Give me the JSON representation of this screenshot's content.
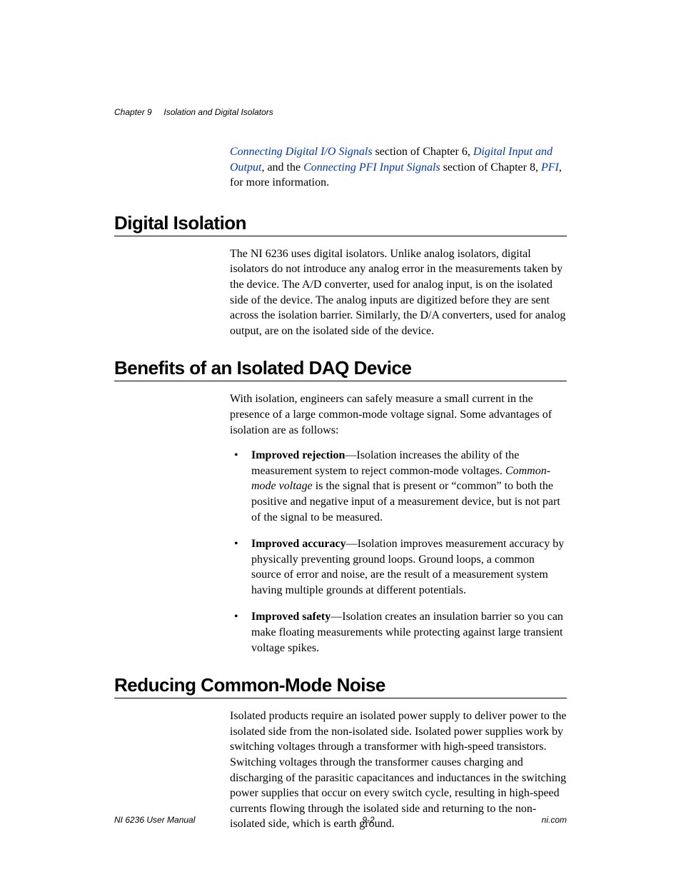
{
  "header": {
    "chapter_label": "Chapter 9",
    "chapter_title": "Isolation and Digital Isolators"
  },
  "intro": {
    "link1": "Connecting Digital I/O Signals",
    "t1": " section of Chapter 6, ",
    "link2": "Digital Input and Output",
    "t2": ", and the ",
    "link3": "Connecting PFI Input Signals",
    "t3": " section of Chapter 8, ",
    "link4": "PFI",
    "t4": ", for more information."
  },
  "sections": {
    "digital_isolation": {
      "heading": "Digital Isolation",
      "body": "The NI 6236 uses digital isolators. Unlike analog isolators, digital isolators do not introduce any analog error in the measurements taken by the device. The A/D converter, used for analog input, is on the isolated side of the device. The analog inputs are digitized before they are sent across the isolation barrier. Similarly, the D/A converters, used for analog output, are on the isolated side of the device."
    },
    "benefits": {
      "heading": "Benefits of an Isolated DAQ Device",
      "intro": "With isolation, engineers can safely measure a small current in the presence of a large common-mode voltage signal. Some advantages of isolation are as follows:",
      "items": [
        {
          "term": "Improved rejection",
          "pre": "—Isolation increases the ability of the measurement system to reject common-mode voltages. ",
          "ital": "Common-mode voltage",
          "post": " is the signal that is present or “common” to both the positive and negative input of a measurement device, but is not part of the signal to be measured."
        },
        {
          "term": "Improved accuracy",
          "pre": "—Isolation improves measurement accuracy by physically preventing ground loops. Ground loops, a common source of error and noise, are the result of a measurement system having multiple grounds at different potentials.",
          "ital": "",
          "post": ""
        },
        {
          "term": "Improved safety",
          "pre": "—Isolation creates an insulation barrier so you can make floating measurements while protecting against large transient voltage spikes.",
          "ital": "",
          "post": ""
        }
      ]
    },
    "reducing": {
      "heading": "Reducing Common-Mode Noise",
      "body": "Isolated products require an isolated power supply to deliver power to the isolated side from the non-isolated side. Isolated power supplies work by switching voltages through a transformer with high-speed transistors. Switching voltages through the transformer causes charging and discharging of the parasitic capacitances and inductances in the switching power supplies that occur on every switch cycle, resulting in high-speed currents flowing through the isolated side and returning to the non-isolated side, which is earth ground."
    }
  },
  "footer": {
    "left": "NI 6236 User Manual",
    "center": "9-2",
    "right": "ni.com"
  }
}
